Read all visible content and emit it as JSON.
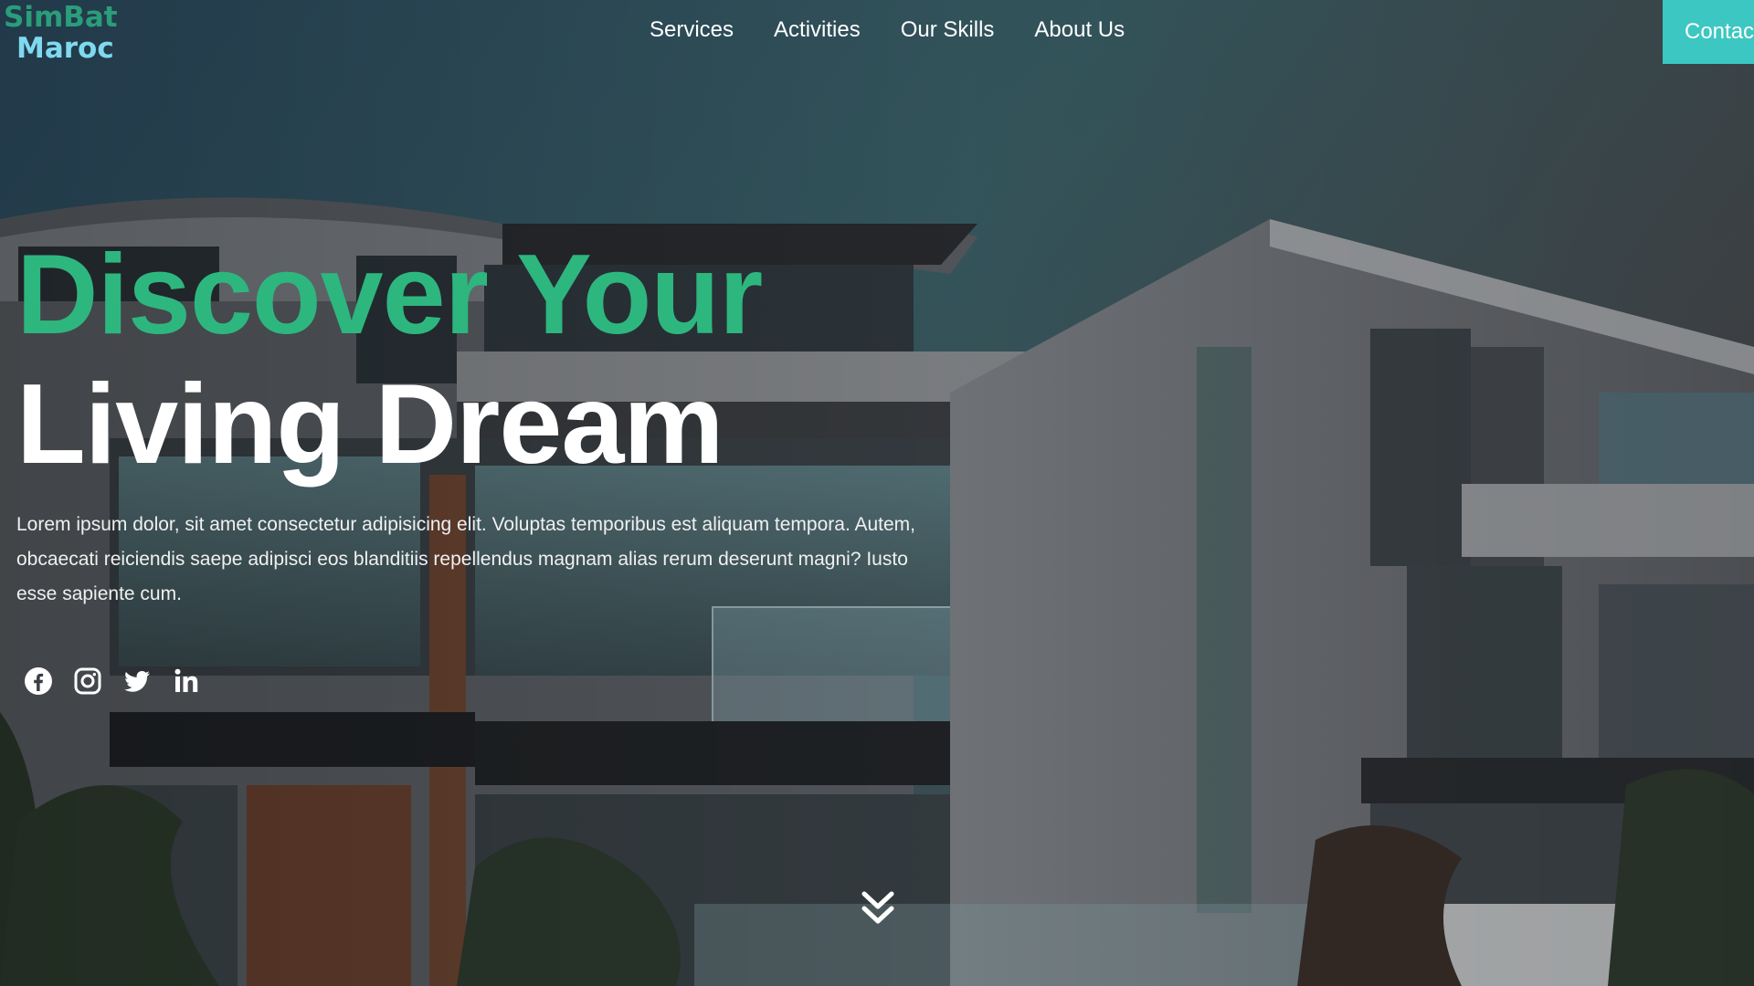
{
  "brand": {
    "line1": "SimBat",
    "line2": "Maroc"
  },
  "nav": {
    "items": [
      {
        "label": "Services"
      },
      {
        "label": "Activities"
      },
      {
        "label": "Our Skills"
      },
      {
        "label": "About Us"
      }
    ],
    "contact_label": "Contact"
  },
  "hero": {
    "headline_1": "Discover Your",
    "headline_2": "Living Dream",
    "lead": "Lorem ipsum dolor, sit amet consectetur adipisicing elit. Voluptas temporibus est aliquam tempora. Autem, obcaecati reiciendis saepe adipisci eos blanditiis repellendus magnam alias rerum deserunt magni? Iusto esse sapiente cum."
  },
  "socials": [
    "facebook-icon",
    "instagram-icon",
    "twitter-icon",
    "linkedin-icon"
  ],
  "colors": {
    "accent_green": "#2eb67f",
    "accent_teal": "#3cc7c2",
    "logo_teal": "#2a9d7a",
    "logo_light": "#7fd9ef"
  }
}
